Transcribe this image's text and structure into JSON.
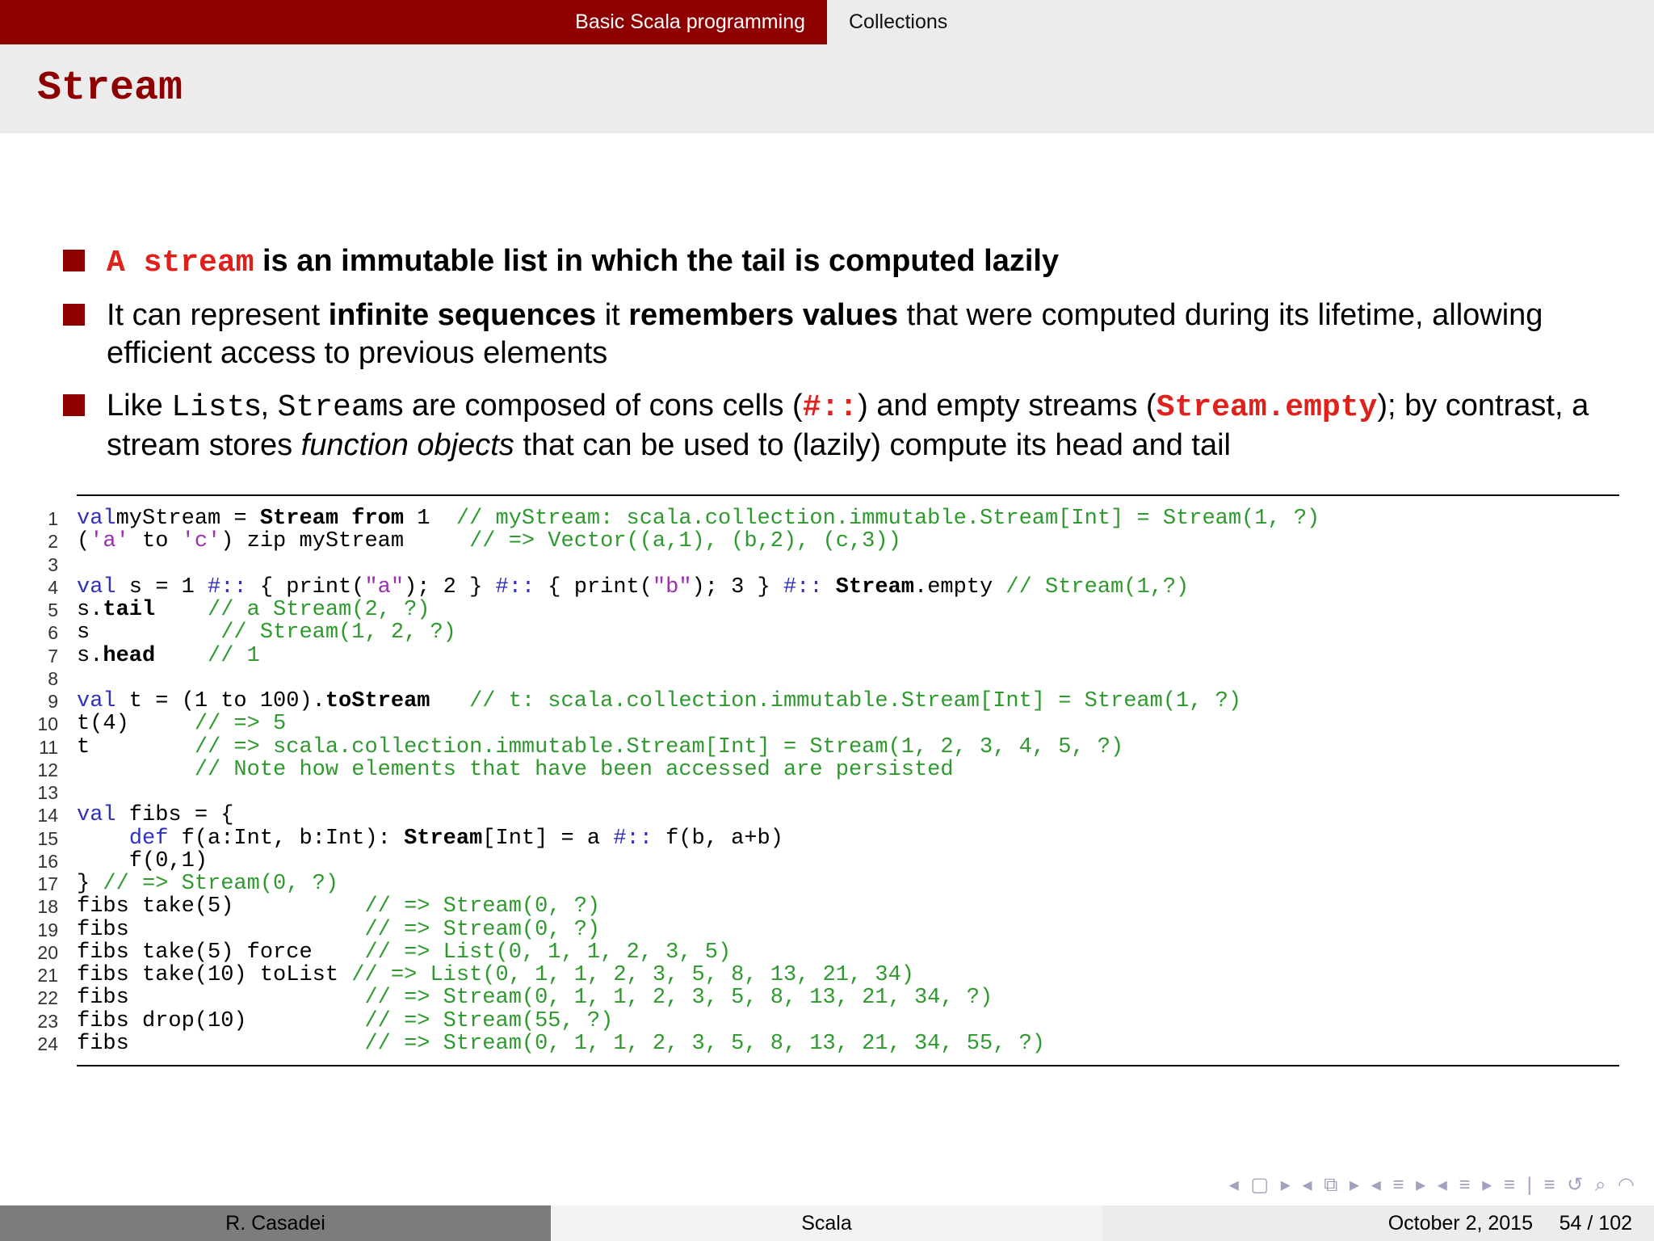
{
  "header": {
    "section_active": "Basic Scala programming",
    "section_next": "Collections",
    "title": "Stream"
  },
  "bullets": {
    "b1_code": "A stream",
    "b1_text": " is an immutable list in which the tail is computed lazily",
    "b2_a": "It can represent ",
    "b2_b": "infinite sequences",
    "b2_c": " it ",
    "b2_d": "remembers values",
    "b2_e": " that were computed during its lifetime, allowing efficient access to previous elements",
    "b3_a": "Like ",
    "b3_b": "List",
    "b3_c": "s, ",
    "b3_d": "Stream",
    "b3_e": "s are composed of cons cells (",
    "b3_f": "#::",
    "b3_g": ") and empty streams (",
    "b3_h": "Stream.empty",
    "b3_i": "); by contrast, a stream stores ",
    "b3_j": "function objects",
    "b3_k": " that can be used to (lazily) compute its head and tail"
  },
  "code_lines": [
    [
      [
        "kw",
        "val"
      ],
      [
        "",
        "myStream = "
      ],
      [
        "b",
        "Stream from"
      ],
      [
        "",
        " 1  "
      ],
      [
        "cm",
        "// myStream: scala.collection.immutable.Stream[Int] = Stream(1, ?)"
      ]
    ],
    [
      [
        "",
        "("
      ],
      [
        "st",
        "'a'"
      ],
      [
        "",
        " to "
      ],
      [
        "st",
        "'c'"
      ],
      [
        "",
        ") zip myStream     "
      ],
      [
        "cm",
        "// => Vector((a,1), (b,2), (c,3))"
      ]
    ],
    [],
    [
      [
        "kw",
        "val"
      ],
      [
        "",
        " s = 1 "
      ],
      [
        "kw",
        "#::"
      ],
      [
        "",
        " { print("
      ],
      [
        "st",
        "\"a\""
      ],
      [
        "",
        "); 2 } "
      ],
      [
        "kw",
        "#::"
      ],
      [
        "",
        " { print("
      ],
      [
        "st",
        "\"b\""
      ],
      [
        "",
        "); 3 } "
      ],
      [
        "kw",
        "#::"
      ],
      [
        "",
        " "
      ],
      [
        "b",
        "Stream"
      ],
      [
        "",
        ".empty "
      ],
      [
        "cm",
        "// Stream(1,?)"
      ]
    ],
    [
      [
        "",
        "s."
      ],
      [
        "b",
        "tail"
      ],
      [
        "",
        "    "
      ],
      [
        "cm",
        "// a Stream(2, ?)"
      ]
    ],
    [
      [
        "",
        "s          "
      ],
      [
        "cm",
        "// Stream(1, 2, ?)"
      ]
    ],
    [
      [
        "",
        "s."
      ],
      [
        "b",
        "head"
      ],
      [
        "",
        "    "
      ],
      [
        "cm",
        "// 1"
      ]
    ],
    [],
    [
      [
        "kw",
        "val"
      ],
      [
        "",
        " t = (1 to 100)."
      ],
      [
        "b",
        "toStream"
      ],
      [
        "",
        "   "
      ],
      [
        "cm",
        "// t: scala.collection.immutable.Stream[Int] = Stream(1, ?)"
      ]
    ],
    [
      [
        "",
        "t(4)     "
      ],
      [
        "cm",
        "// => 5"
      ]
    ],
    [
      [
        "",
        "t        "
      ],
      [
        "cm",
        "// => scala.collection.immutable.Stream[Int] = Stream(1, 2, 3, 4, 5, ?)"
      ]
    ],
    [
      [
        "",
        "         "
      ],
      [
        "cm",
        "// Note how elements that have been accessed are persisted"
      ]
    ],
    [],
    [
      [
        "kw",
        "val"
      ],
      [
        "",
        " fibs = {"
      ]
    ],
    [
      [
        "",
        "    "
      ],
      [
        "kw",
        "def"
      ],
      [
        "",
        " f(a:Int, b:Int): "
      ],
      [
        "b",
        "Stream"
      ],
      [
        "",
        "[Int] = a "
      ],
      [
        "kw",
        "#::"
      ],
      [
        "",
        " f(b, a+b)"
      ]
    ],
    [
      [
        "",
        "    f(0,1)"
      ]
    ],
    [
      [
        "",
        "} "
      ],
      [
        "cm",
        "// => Stream(0, ?)"
      ]
    ],
    [
      [
        "",
        "fibs take(5)          "
      ],
      [
        "cm",
        "// => Stream(0, ?)"
      ]
    ],
    [
      [
        "",
        "fibs                  "
      ],
      [
        "cm",
        "// => Stream(0, ?)"
      ]
    ],
    [
      [
        "",
        "fibs take(5) force    "
      ],
      [
        "cm",
        "// => List(0, 1, 1, 2, 3, 5)"
      ]
    ],
    [
      [
        "",
        "fibs take(10) toList "
      ],
      [
        "cm",
        "// => List(0, 1, 1, 2, 3, 5, 8, 13, 21, 34)"
      ]
    ],
    [
      [
        "",
        "fibs                  "
      ],
      [
        "cm",
        "// => Stream(0, 1, 1, 2, 3, 5, 8, 13, 21, 34, ?)"
      ]
    ],
    [
      [
        "",
        "fibs drop(10)         "
      ],
      [
        "cm",
        "// => Stream(55, ?)"
      ]
    ],
    [
      [
        "",
        "fibs                  "
      ],
      [
        "cm",
        "// => Stream(0, 1, 1, 2, 3, 5, 8, 13, 21, 34, 55, ?)"
      ]
    ]
  ],
  "nav_icons": "◂ ▢ ▸ ◂ ⧉ ▸ ◂ ≡ ▸ ◂ ≡ ▸ ≡ | ≡ ↺ ⌕ ◠",
  "footer": {
    "author": "R. Casadei",
    "short_title": "Scala",
    "date": "October 2, 2015",
    "page": "54 / 102"
  }
}
